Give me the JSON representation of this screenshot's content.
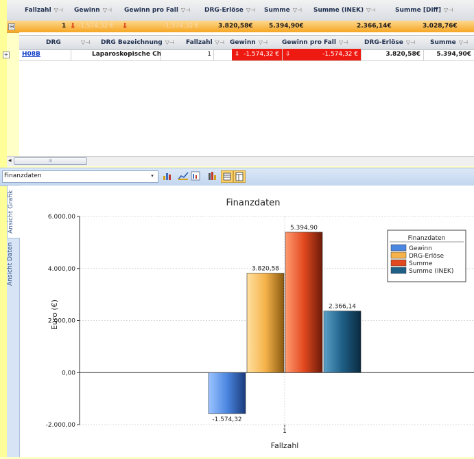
{
  "outer_grid": {
    "headers": [
      "Fallzahl",
      "Gewinn",
      "Gewinn pro Fall",
      "DRG-Erlöse",
      "Summe",
      "Summe (INEK)",
      "Summe [Diff]"
    ],
    "summary_row": {
      "expander": "⊟",
      "fallzahl": "1",
      "gewinn": "-1.574,32 €",
      "gewinn_pro_fall": "-1.574,32 €",
      "drg_erloese": "3.820,58€",
      "summe": "5.394,90€",
      "summe_inek": "2.366,14€",
      "summe_diff": "3.028,76€"
    }
  },
  "inner_grid": {
    "headers": [
      "DRG",
      "DRG Bezeichnung",
      "Fallzahl",
      "Gewinn",
      "Gewinn pro Fall",
      "DRG-Erlöse",
      "Summe"
    ],
    "rows": [
      {
        "expander": "+",
        "drg": "H08B",
        "bezeichnung": "Laparoskopische Cholezy",
        "fallzahl": "1",
        "gewinn": "-1.574,32 €",
        "gewinn_pro_fall": "-1.574,32 €",
        "drg_erloese": "3.820,58€",
        "summe": "5.394,90€"
      }
    ]
  },
  "scroll": {
    "left_arrow": "◂",
    "grip": "III"
  },
  "toolbar": {
    "combo_value": "Finanzdaten",
    "combo_arrow": "▾"
  },
  "tabs": {
    "grafik": "Ansicht Grafik",
    "daten": "Ansicht Daten"
  },
  "chart_data": {
    "type": "bar",
    "title": "Finanzdaten",
    "xlabel": "Fallzahl",
    "ylabel": "Euro (€)",
    "categories": [
      "1"
    ],
    "series": [
      {
        "name": "Gewinn",
        "values": [
          -1574.32
        ],
        "label": "-1.574,32",
        "color": "#4b86e0"
      },
      {
        "name": "DRG-Erlöse",
        "values": [
          3820.58
        ],
        "label": "3.820,58",
        "color": "#f5b24a"
      },
      {
        "name": "Summe",
        "values": [
          5394.9
        ],
        "label": "5.394,90",
        "color": "#e2491f"
      },
      {
        "name": "Summe (INEK)",
        "values": [
          2366.14
        ],
        "label": "2.366,14",
        "color": "#1f5f86"
      }
    ],
    "ylim": [
      -2000,
      6000
    ],
    "yticks": [
      6000,
      4000,
      2000,
      0,
      -2000
    ],
    "ytick_labels": [
      "6.000,00",
      "4.000,00",
      "2.000,00",
      "0,00",
      "-2.000,00"
    ],
    "legend_title": "Finanzdaten",
    "legend_placement": "top-right",
    "grid": true
  }
}
